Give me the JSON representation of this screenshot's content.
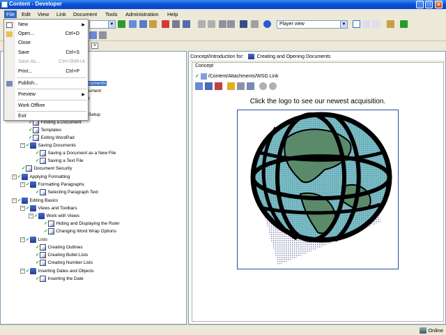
{
  "window": {
    "title": "Content - Developer"
  },
  "menubar": [
    "File",
    "Edit",
    "View",
    "Link",
    "Document",
    "Tools",
    "Administration",
    "Help"
  ],
  "toolbar": {
    "view_select": "Player view"
  },
  "file_menu": {
    "new": "New",
    "open": "Open...",
    "open_shortcut": "Ctrl+O",
    "close": "Close",
    "save": "Save",
    "save_shortcut": "Ctrl+S",
    "save_as": "Save As...",
    "save_as_shortcut": "Ctrl+Shift+A",
    "print": "Print...",
    "print_shortcut": "Ctrl+P",
    "publish": "Publish...",
    "preview": "Preview",
    "work_offline": "Work Offline",
    "exit": "Exit"
  },
  "tree": {
    "items": [
      {
        "label": "ocuments",
        "selected": true
      },
      {
        "label": "ument"
      },
      {
        "label": "t"
      },
      {
        "label": "Setup"
      },
      {
        "label": "Finding a Document"
      },
      {
        "label": "Templates"
      },
      {
        "label": "Exiting WordPad"
      },
      {
        "label": "Saving Documents"
      },
      {
        "label": "Saving a Document as a New File"
      },
      {
        "label": "Saving a Text File"
      },
      {
        "label": "Document Security"
      },
      {
        "label": "Applying Formatting"
      },
      {
        "label": "Formatting Paragraphs"
      },
      {
        "label": "Selecting Paragraph Text"
      },
      {
        "label": "Editing Basics"
      },
      {
        "label": "Views and Toolbars"
      },
      {
        "label": "Work with Views"
      },
      {
        "label": "Hiding and Displaying the Ruler"
      },
      {
        "label": "Changing Word Wrap Options"
      },
      {
        "label": "Lists"
      },
      {
        "label": "Creating Outlines"
      },
      {
        "label": "Creating Bullet Lists"
      },
      {
        "label": "Creating Number Lists"
      },
      {
        "label": "Inserting Dates and Objects"
      },
      {
        "label": "Inserting the Date"
      }
    ]
  },
  "concept_panel": {
    "header_label": "Concept/Introduction for:",
    "header_title": "Creating and Opening Documents",
    "section_label": "Concept",
    "path": "/Content/Attachments/WSG Link",
    "caption": "Click the logo to see our newest acquisition."
  },
  "status": {
    "text": "Online"
  }
}
